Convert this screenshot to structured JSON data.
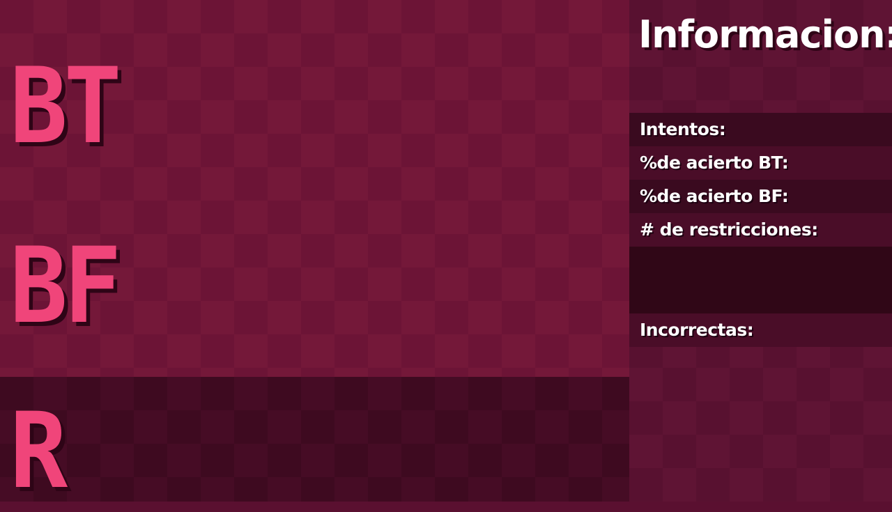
{
  "board": {
    "label_bt": "BT",
    "label_bf": "BF",
    "label_r": "R"
  },
  "info_panel": {
    "title": "Informacion:",
    "intentos_label": "Intentos:",
    "acierto_bt_label": "%de acierto BT:",
    "acierto_bf_label": "%de acierto BF:",
    "restricciones_label": "# de restricciones:",
    "incorrectas_label": "Incorrectas:"
  },
  "colors": {
    "accent": "#f0457a",
    "board_dark": "#6c1436",
    "board_light": "#741839",
    "panel_bg": "#581130"
  }
}
